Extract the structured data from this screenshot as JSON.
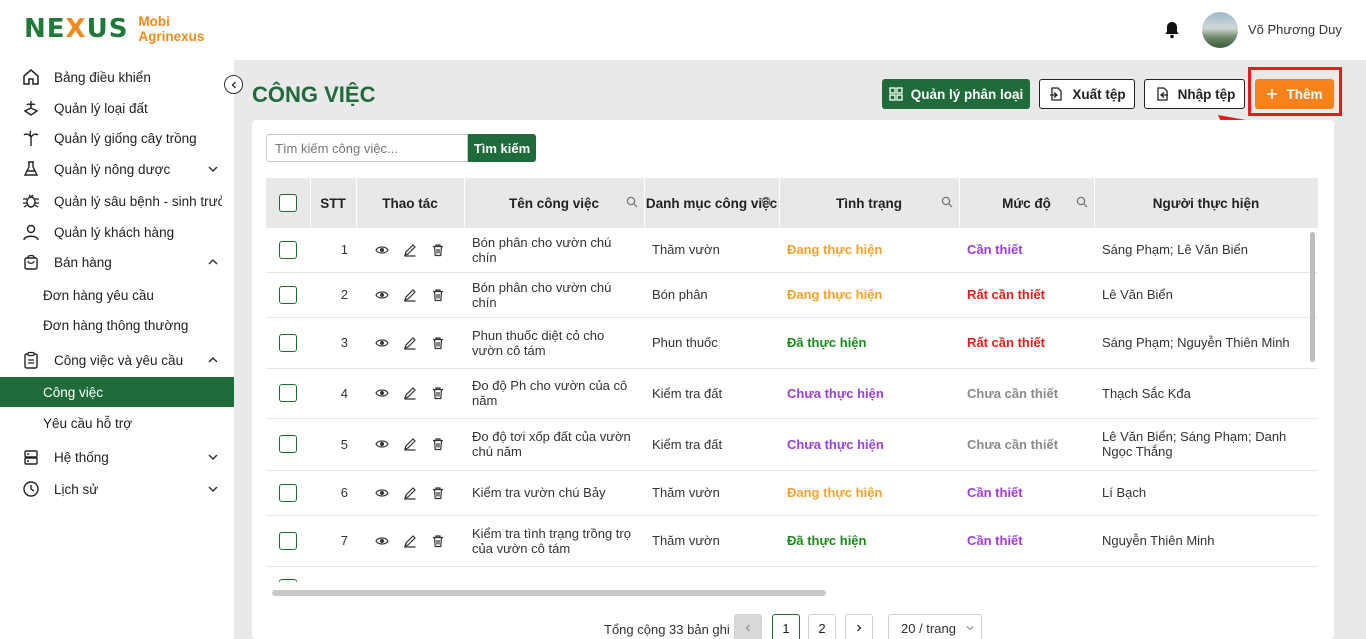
{
  "brand": {
    "mark": "NEXUS",
    "name_line1": "Mobi",
    "name_line2": "Agrinexus"
  },
  "user": {
    "name": "Võ Phương Duy"
  },
  "sidebar": {
    "items": [
      {
        "label": "Bảng điều khiển",
        "icon": "home-icon"
      },
      {
        "label": "Quản lý loại đất",
        "icon": "soil-icon"
      },
      {
        "label": "Quản lý giống cây trồng",
        "icon": "plant-icon"
      },
      {
        "label": "Quản lý nông dược",
        "icon": "flask-icon"
      },
      {
        "label": "Quản lý sâu bệnh - sinh trưởng",
        "icon": "bug-icon"
      },
      {
        "label": "Quản lý khách hàng",
        "icon": "user-icon"
      },
      {
        "label": "Bán hàng",
        "icon": "bag-icon"
      },
      {
        "label": "Công việc và yêu cầu",
        "icon": "clipboard-icon"
      },
      {
        "label": "Hệ thống",
        "icon": "system-icon"
      },
      {
        "label": "Lịch sử",
        "icon": "history-icon"
      }
    ],
    "sales_sub": [
      "Đơn hàng yêu cầu",
      "Đơn hàng thông thường"
    ],
    "work_sub": [
      "Công việc",
      "Yêu cầu hỗ trợ"
    ]
  },
  "page": {
    "title": "CÔNG VIỆC",
    "buttons": {
      "manage_categories": "Quản lý phân loại",
      "export": "Xuất tệp",
      "import": "Nhập tệp",
      "add": "Thêm"
    },
    "search": {
      "placeholder": "Tìm kiếm công việc...",
      "button": "Tìm kiếm"
    }
  },
  "table": {
    "headers": [
      "STT",
      "Thao tác",
      "Tên công việc",
      "Danh mục công việc",
      "Tình trạng",
      "Mức độ",
      "Người thực hiện"
    ],
    "rows": [
      {
        "stt": "1",
        "name": "Bón phân cho vườn chú chín",
        "category": "Thăm vườn",
        "status": "Đang thực hiện",
        "status_color": "orange",
        "level": "Cần thiết",
        "level_color": "purple",
        "assignee": "Sáng Phạm; Lê  Văn Biển"
      },
      {
        "stt": "2",
        "name": "Bón phân cho vườn chú chín",
        "category": "Bón phân",
        "status": "Đang thực hiện",
        "status_color": "orange",
        "level": "Rất cần thiết",
        "level_color": "red",
        "assignee": "Lê  Văn Biển"
      },
      {
        "stt": "3",
        "name": "Phun thuốc diệt cỏ cho vườn cô tám",
        "category": "Phun thuốc",
        "status": "Đã thực hiện",
        "status_color": "green",
        "level": "Rất cần thiết",
        "level_color": "red",
        "assignee": "Sáng Phạm; Nguyễn  Thiên Minh"
      },
      {
        "stt": "4",
        "name": "Đo độ Ph cho vườn của cô năm",
        "category": "Kiểm tra đất",
        "status": "Chưa thực hiện",
        "status_color": "purple",
        "level": "Chưa cần thiết",
        "level_color": "grey",
        "assignee": "Thạch Sắc Kđa"
      },
      {
        "stt": "5",
        "name": "Đo độ tơi xốp đất của vườn chú năm",
        "category": "Kiểm tra đất",
        "status": "Chưa thực hiện",
        "status_color": "purple",
        "level": "Chưa cần thiết",
        "level_color": "grey",
        "assignee": "Lê  Văn Biển; Sáng Phạm; Danh  Ngọc Thắng"
      },
      {
        "stt": "6",
        "name": "Kiểm tra vườn chú Bảy",
        "category": "Thăm vườn",
        "status": "Đang thực hiện",
        "status_color": "orange",
        "level": "Cần thiết",
        "level_color": "purple",
        "assignee": "Lí  Bạch"
      },
      {
        "stt": "7",
        "name": "Kiểm tra tình trạng trồng trọ của vườn cô tám",
        "category": "Thăm vườn",
        "status": "Đã thực hiện",
        "status_color": "green",
        "level": "Cần thiết",
        "level_color": "purple",
        "assignee": "Nguyễn  Thiên Minh"
      }
    ]
  },
  "pagination": {
    "total": "Tổng cộng 33 bản ghi",
    "pages": [
      "1",
      "2"
    ],
    "page_size": "20 / trang"
  },
  "colors": {
    "brand_green": "#1f6b3a",
    "accent_orange": "#f7821b",
    "highlight_red": "#e51c1c"
  }
}
